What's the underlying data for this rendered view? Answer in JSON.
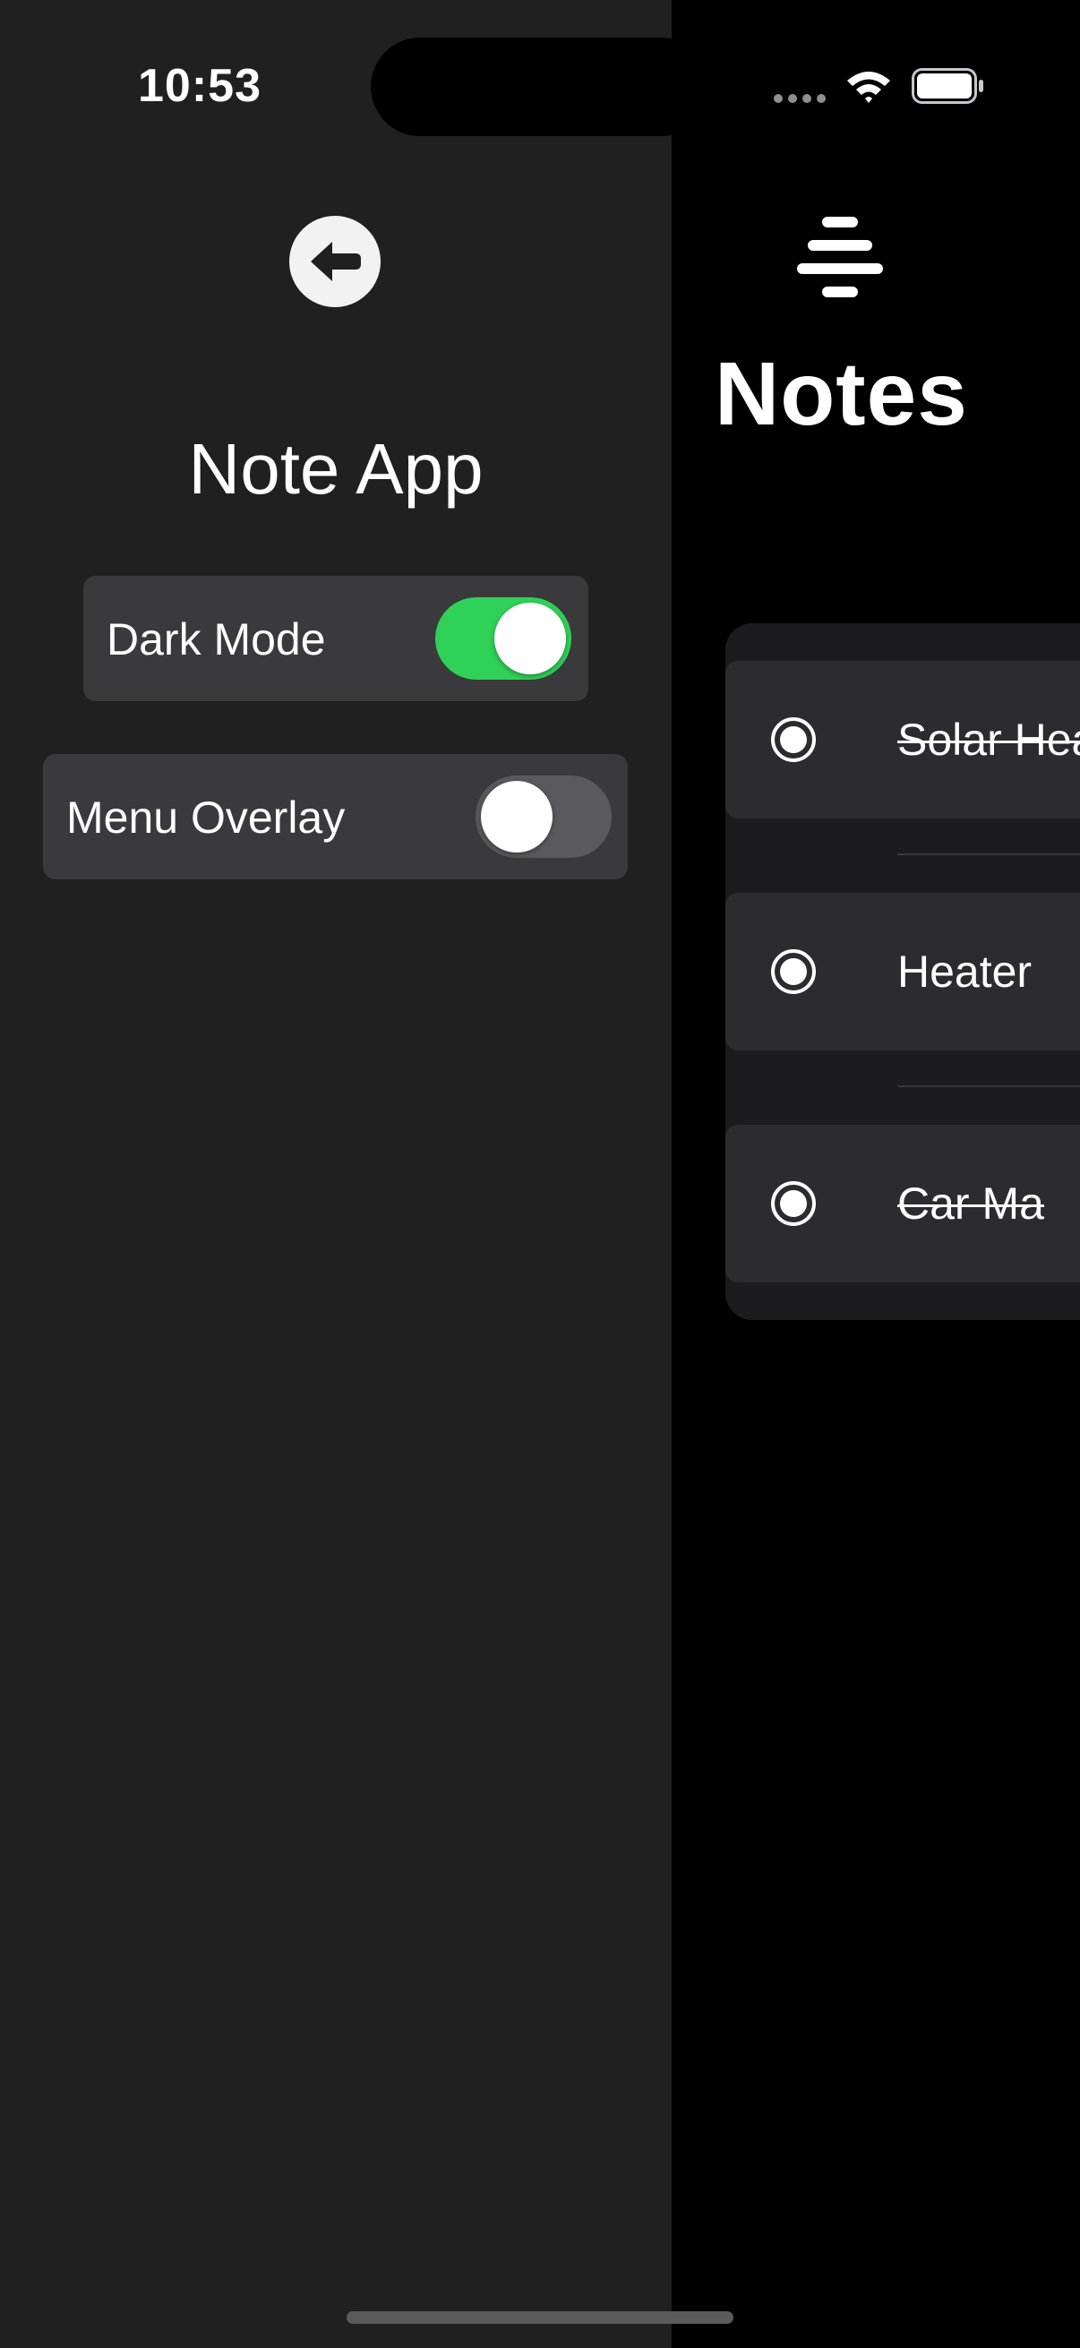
{
  "status_bar": {
    "time": "10:53",
    "icons": [
      "signal-dots-icon",
      "wifi-icon",
      "battery-icon"
    ]
  },
  "side_menu": {
    "back_icon": "arrow-left-circle-icon",
    "title": "Note App",
    "settings": [
      {
        "label": "Dark Mode",
        "enabled": true
      },
      {
        "label": "Menu Overlay",
        "enabled": false
      }
    ]
  },
  "notes_screen": {
    "filter_icon": "filter-lines-icon",
    "title": "Notes",
    "notes": [
      {
        "text": "Solar Heater",
        "completed": true
      },
      {
        "text": "Heater",
        "completed": false
      },
      {
        "text": "Car Ma",
        "completed": true
      }
    ]
  },
  "colors": {
    "menu_background": "#202020",
    "screen_background": "#000000",
    "card_background": "#3a3a3c",
    "toggle_on": "#30d158",
    "toggle_off": "#5a5a5e"
  }
}
